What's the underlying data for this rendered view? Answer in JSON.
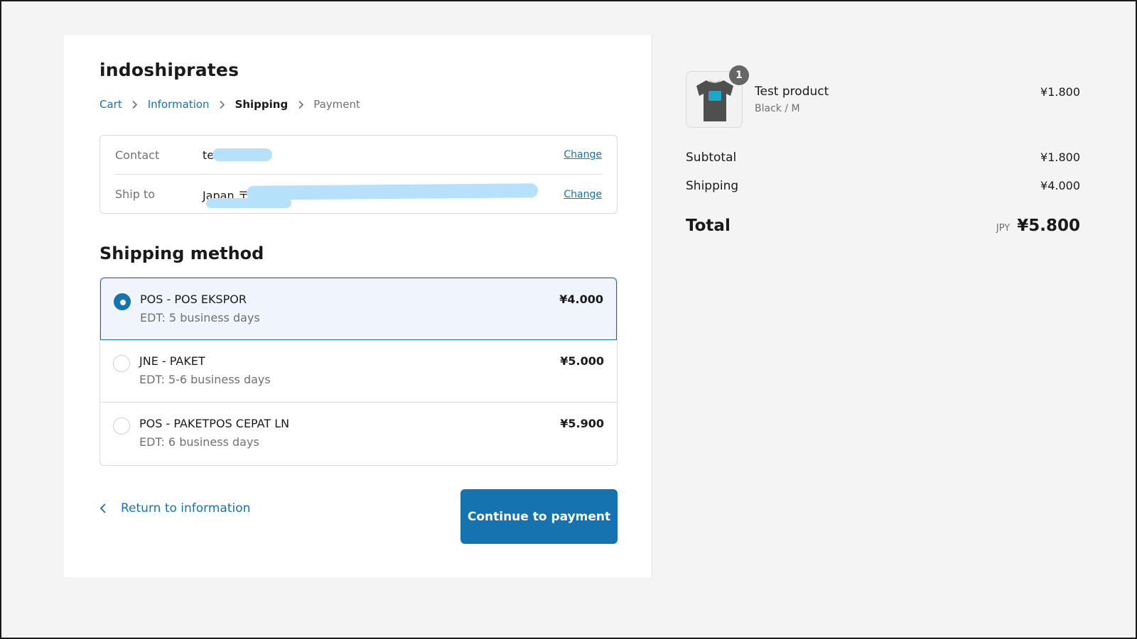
{
  "shop": {
    "name": "indoshiprates"
  },
  "breadcrumb": {
    "items": [
      {
        "label": "Cart",
        "state": "link"
      },
      {
        "label": "Information",
        "state": "link"
      },
      {
        "label": "Shipping",
        "state": "current"
      },
      {
        "label": "Payment",
        "state": "muted"
      }
    ]
  },
  "review": {
    "contact": {
      "label": "Contact",
      "value": "te com",
      "change": "Change"
    },
    "ship_to": {
      "label": "Ship to",
      "value": "Japan 〒",
      "change": "Change"
    }
  },
  "shipping": {
    "title": "Shipping method",
    "methods": [
      {
        "name": "POS - POS EKSPOR",
        "edt": "EDT: 5 business days",
        "price": "¥4.000",
        "selected": true
      },
      {
        "name": "JNE - PAKET",
        "edt": "EDT: 5-6 business days",
        "price": "¥5.000",
        "selected": false
      },
      {
        "name": "POS - PAKETPOS CEPAT LN",
        "edt": "EDT: 6 business days",
        "price": "¥5.900",
        "selected": false
      }
    ]
  },
  "footer": {
    "return_label": "Return to information",
    "continue_label": "Continue to payment"
  },
  "summary": {
    "product": {
      "name": "Test product",
      "variant": "Black / M",
      "price": "¥1.800",
      "quantity": "1"
    },
    "subtotal": {
      "label": "Subtotal",
      "amount": "¥1.800"
    },
    "shipping": {
      "label": "Shipping",
      "amount": "¥4.000"
    },
    "total": {
      "label": "Total",
      "currency": "JPY",
      "amount": "¥5.800"
    }
  },
  "colors": {
    "accent": "#1773b0",
    "selected_bg": "#f0f5fd",
    "redaction": "#b7e1fb"
  },
  "icons": {
    "breadcrumb_separator": "chevron-right-icon",
    "return": "chevron-left-icon",
    "product_image": "tshirt-icon"
  }
}
